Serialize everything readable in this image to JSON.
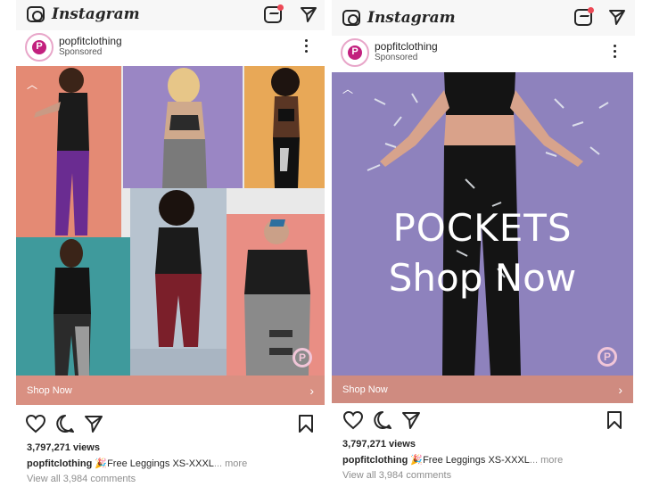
{
  "app": {
    "name": "Instagram"
  },
  "posts": [
    {
      "account": "popfitclothing",
      "sponsored": "Sponsored",
      "cta": "Shop Now",
      "views": "3,797,271 views",
      "caption_user": "popfitclothing",
      "caption_text": "🎉Free Leggings XS-XXXL",
      "caption_more": "... more",
      "comments": "View all 3,984 comments",
      "brand_badge": "P"
    },
    {
      "account": "popfitclothing",
      "sponsored": "Sponsored",
      "overlay_line1": "POCKETS",
      "overlay_line2": "Shop Now",
      "cta": "Shop Now",
      "views": "3,797,271 views",
      "caption_user": "popfitclothing",
      "caption_text": "🎉Free Leggings XS-XXXL",
      "caption_more": "... more",
      "comments": "View all 3,984 comments",
      "brand_badge": "P"
    }
  ],
  "icons": [
    "camera-icon",
    "igtv-icon",
    "direct-message-icon",
    "more-options-icon",
    "like-icon",
    "comment-icon",
    "share-icon",
    "save-icon"
  ],
  "colors": {
    "cta_bar": "#d99082",
    "notification_dot": "#ed4956",
    "brand": "#c2207e",
    "purple_bg": "#8e82bd"
  }
}
